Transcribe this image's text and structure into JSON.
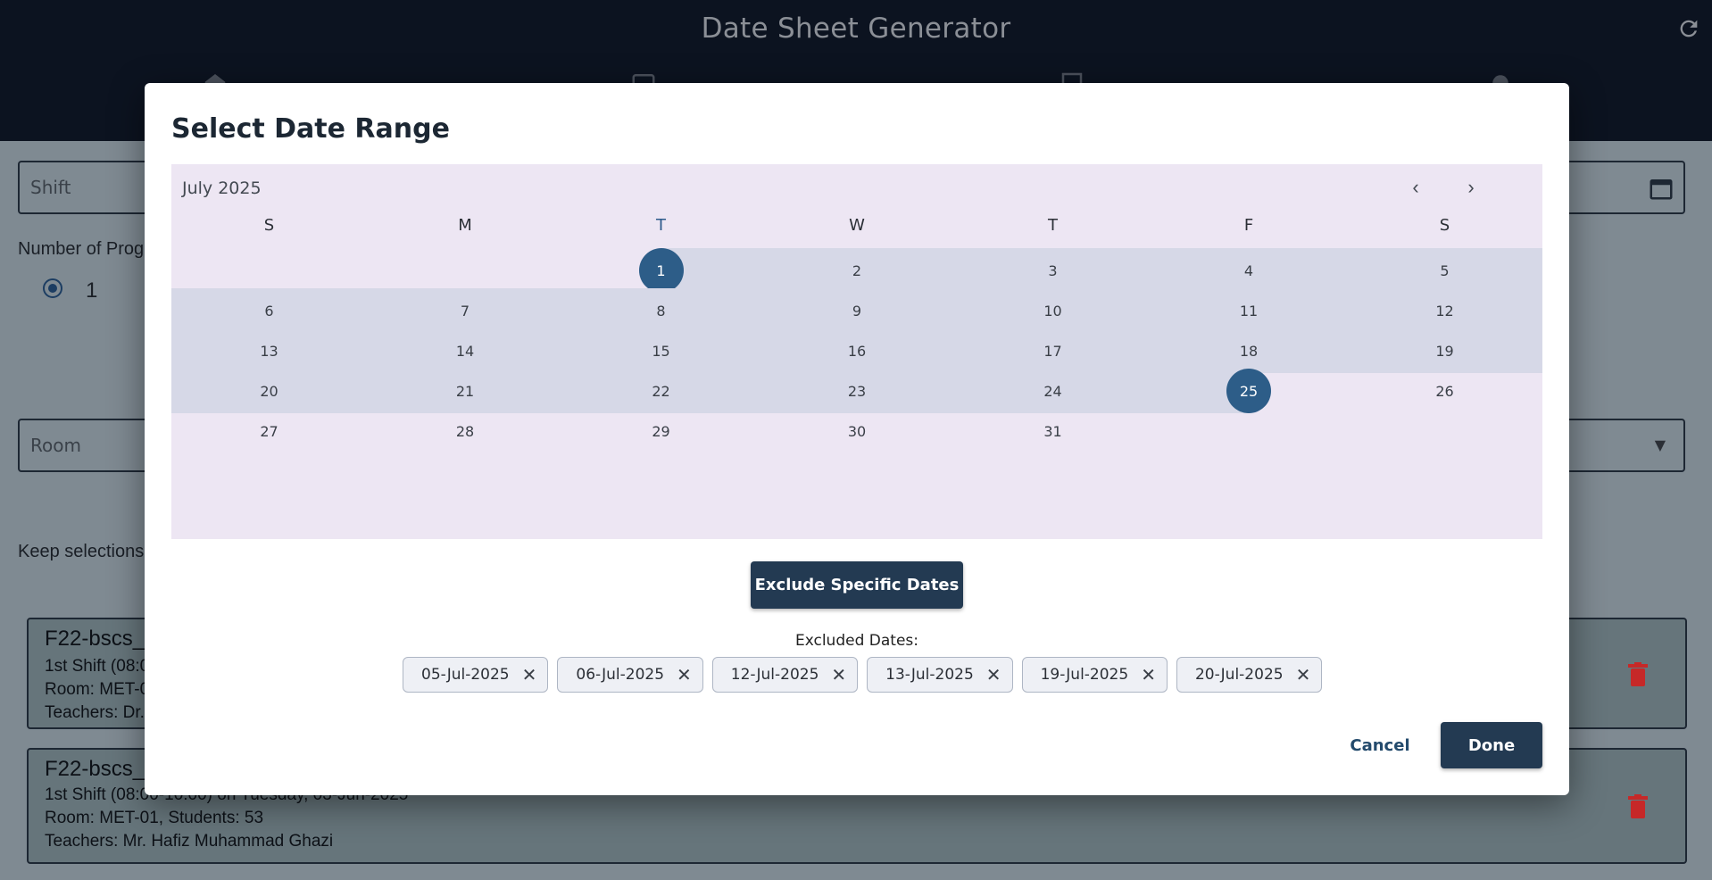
{
  "app": {
    "title": "Date Sheet Generator"
  },
  "background": {
    "shift_label": "Shift",
    "programs_label": "Number of Prog",
    "programs_value": "1",
    "room_label": "Room",
    "keep_label": "Keep selections",
    "cards": [
      {
        "title": "F22-bscs_",
        "line1": "1st Shift (08:0",
        "line2": "Room: MET-0",
        "line3": "Teachers: Dr."
      },
      {
        "title": "F22-bscs_",
        "line1": "1st Shift (08:00-10:00) on Tuesday, 03-Jun-2025",
        "line2": "Room: MET-01, Students: 53",
        "line3": "Teachers: Mr. Hafiz Muhammad Ghazi"
      }
    ]
  },
  "dialog": {
    "title": "Select Date Range",
    "calendar": {
      "month": "July 2025",
      "weekdays": [
        "S",
        "M",
        "T",
        "W",
        "T",
        "F",
        "S"
      ],
      "today_weekday_index": 2,
      "weeks": [
        [
          "",
          "",
          "1",
          "2",
          "3",
          "4",
          "5"
        ],
        [
          "6",
          "7",
          "8",
          "9",
          "10",
          "11",
          "12"
        ],
        [
          "13",
          "14",
          "15",
          "16",
          "17",
          "18",
          "19"
        ],
        [
          "20",
          "21",
          "22",
          "23",
          "24",
          "25",
          "26"
        ],
        [
          "27",
          "28",
          "29",
          "30",
          "31",
          "",
          ""
        ]
      ],
      "range_start": "1",
      "range_end": "25"
    },
    "exclude_button": "Exclude Specific Dates",
    "excluded_label": "Excluded Dates:",
    "excluded_dates": [
      "05-Jul-2025",
      "06-Jul-2025",
      "12-Jul-2025",
      "13-Jul-2025",
      "19-Jul-2025",
      "20-Jul-2025"
    ],
    "cancel_label": "Cancel",
    "done_label": "Done"
  },
  "colors": {
    "primary": "#233a52",
    "selected_day": "#2d5d88",
    "range_band": "#d6d8e7",
    "calendar_bg": "#ede6f3",
    "danger": "#c62828"
  }
}
